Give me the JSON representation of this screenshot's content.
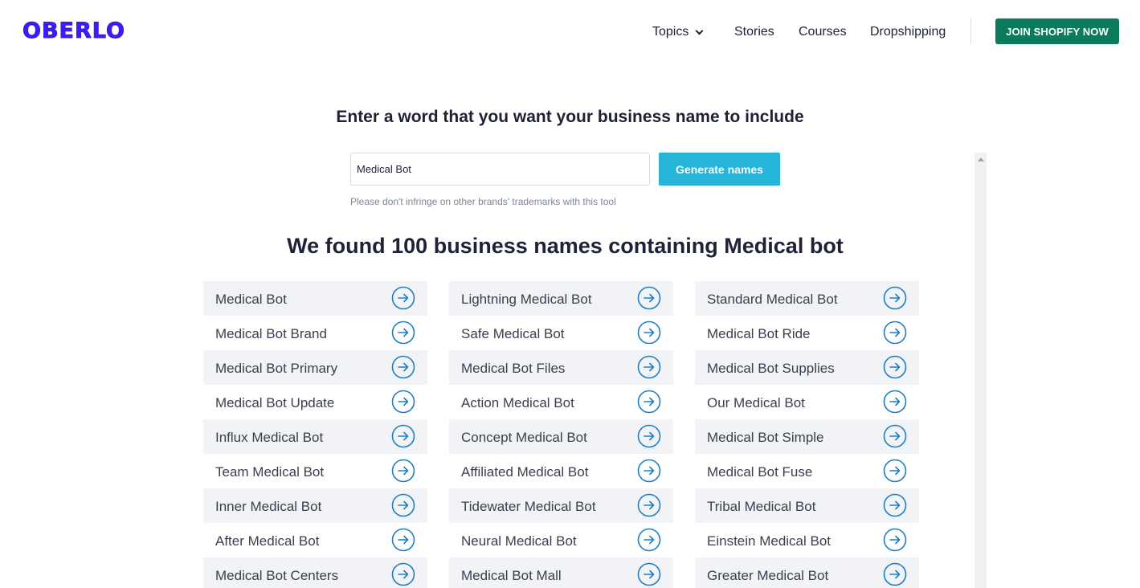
{
  "brand": {
    "logo": "OBERLO",
    "color": "#3b1df0"
  },
  "nav": {
    "topics": "Topics",
    "stories": "Stories",
    "courses": "Courses",
    "dropshipping": "Dropshipping",
    "join": "JOIN SHOPIFY NOW"
  },
  "generator": {
    "prompt": "Enter a word that you want your business name to include",
    "input_value": "Medical Bot",
    "button": "Generate names",
    "note": "Please don't infringe on other brands' trademarks with this tool"
  },
  "results": {
    "title": "We found 100 business names containing Medical bot",
    "columns": [
      [
        "Medical Bot",
        "Medical Bot Brand",
        "Medical Bot Primary",
        "Medical Bot Update",
        "Influx Medical Bot",
        "Team Medical Bot",
        "Inner Medical Bot",
        "After Medical Bot",
        "Medical Bot Centers"
      ],
      [
        "Lightning Medical Bot",
        "Safe Medical Bot",
        "Medical Bot Files",
        "Action Medical Bot",
        "Concept Medical Bot",
        "Affiliated Medical Bot",
        "Tidewater Medical Bot",
        "Neural Medical Bot",
        "Medical Bot Mall"
      ],
      [
        "Standard Medical Bot",
        "Medical Bot Ride",
        "Medical Bot Supplies",
        "Our Medical Bot",
        "Medical Bot Simple",
        "Medical Bot Fuse",
        "Tribal Medical Bot",
        "Einstein Medical Bot",
        "Greater Medical Bot"
      ]
    ],
    "arrow_icon": "arrow-right-circle-icon",
    "accent": "#1d7fc1"
  }
}
